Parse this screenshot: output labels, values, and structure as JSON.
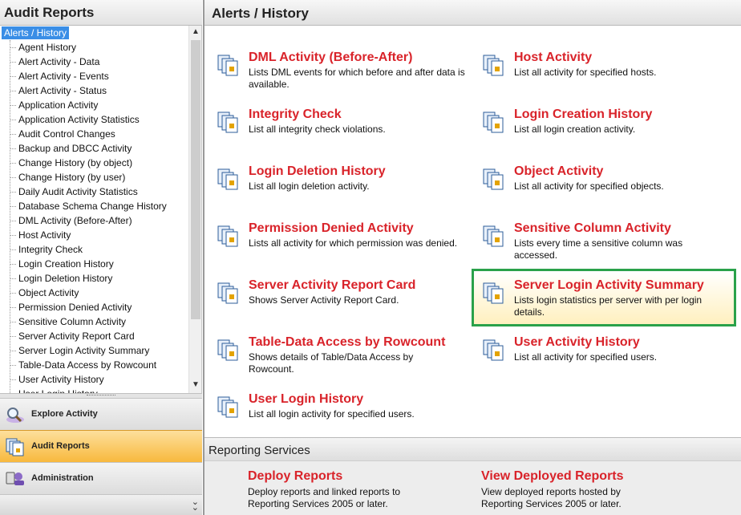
{
  "left_panel": {
    "title": "Audit Reports",
    "tree_root": "Alerts /  History",
    "tree_items": [
      "Agent History",
      "Alert Activity - Data",
      "Alert Activity - Events",
      "Alert Activity - Status",
      "Application Activity",
      "Application Activity Statistics",
      "Audit Control Changes",
      "Backup and DBCC Activity",
      "Change History (by object)",
      "Change History (by user)",
      "Daily Audit Activity Statistics",
      "Database Schema Change History",
      "DML Activity (Before-After)",
      "Host Activity",
      "Integrity Check",
      "Login Creation History",
      "Login Deletion History",
      "Object Activity",
      "Permission Denied Activity",
      "Sensitive Column Activity",
      "Server Activity Report Card",
      "Server Login Activity Summary",
      "Table-Data Access by Rowcount",
      "User Activity History",
      "User Login History"
    ],
    "nav": {
      "explore": "Explore Activity",
      "audit": "Audit Reports",
      "admin": "Administration"
    }
  },
  "right_panel": {
    "title": "Alerts /  History",
    "reports": [
      {
        "title": "DML Activity (Before-After)",
        "desc": "Lists DML events for which before and after data is available."
      },
      {
        "title": "Host Activity",
        "desc": "List all activity for specified hosts."
      },
      {
        "title": "Integrity Check",
        "desc": "List all integrity check violations."
      },
      {
        "title": "Login Creation History",
        "desc": "List all login creation activity."
      },
      {
        "title": "Login Deletion History",
        "desc": "List all login deletion activity."
      },
      {
        "title": "Object Activity",
        "desc": "List all activity for specified objects."
      },
      {
        "title": "Permission Denied Activity",
        "desc": "Lists all activity for which permission was denied."
      },
      {
        "title": "Sensitive Column Activity",
        "desc": "Lists every time a sensitive column was accessed."
      },
      {
        "title": "Server Activity Report Card",
        "desc": "Shows Server Activity Report Card."
      },
      {
        "title": "Server Login Activity Summary",
        "desc": "Lists login statistics per server with per login details."
      },
      {
        "title": "Table-Data Access by Rowcount",
        "desc": "Shows details of Table/Data Access by Rowcount."
      },
      {
        "title": "User Activity History",
        "desc": "List all activity for specified users."
      },
      {
        "title": "User Login History",
        "desc": "List all login activity for specified users."
      }
    ],
    "reporting_services": {
      "header": "Reporting Services",
      "deploy": {
        "title": "Deploy Reports",
        "desc": "Deploy reports and linked reports to Reporting Services 2005 or later."
      },
      "view": {
        "title": "View Deployed Reports",
        "desc": "View deployed reports hosted by Reporting Services 2005 or later."
      }
    }
  },
  "colors": {
    "report_title": "#d9232a",
    "selection": "#3a8ee6",
    "highlight_border": "#2aa14a",
    "active_nav": "#f8b93d"
  }
}
